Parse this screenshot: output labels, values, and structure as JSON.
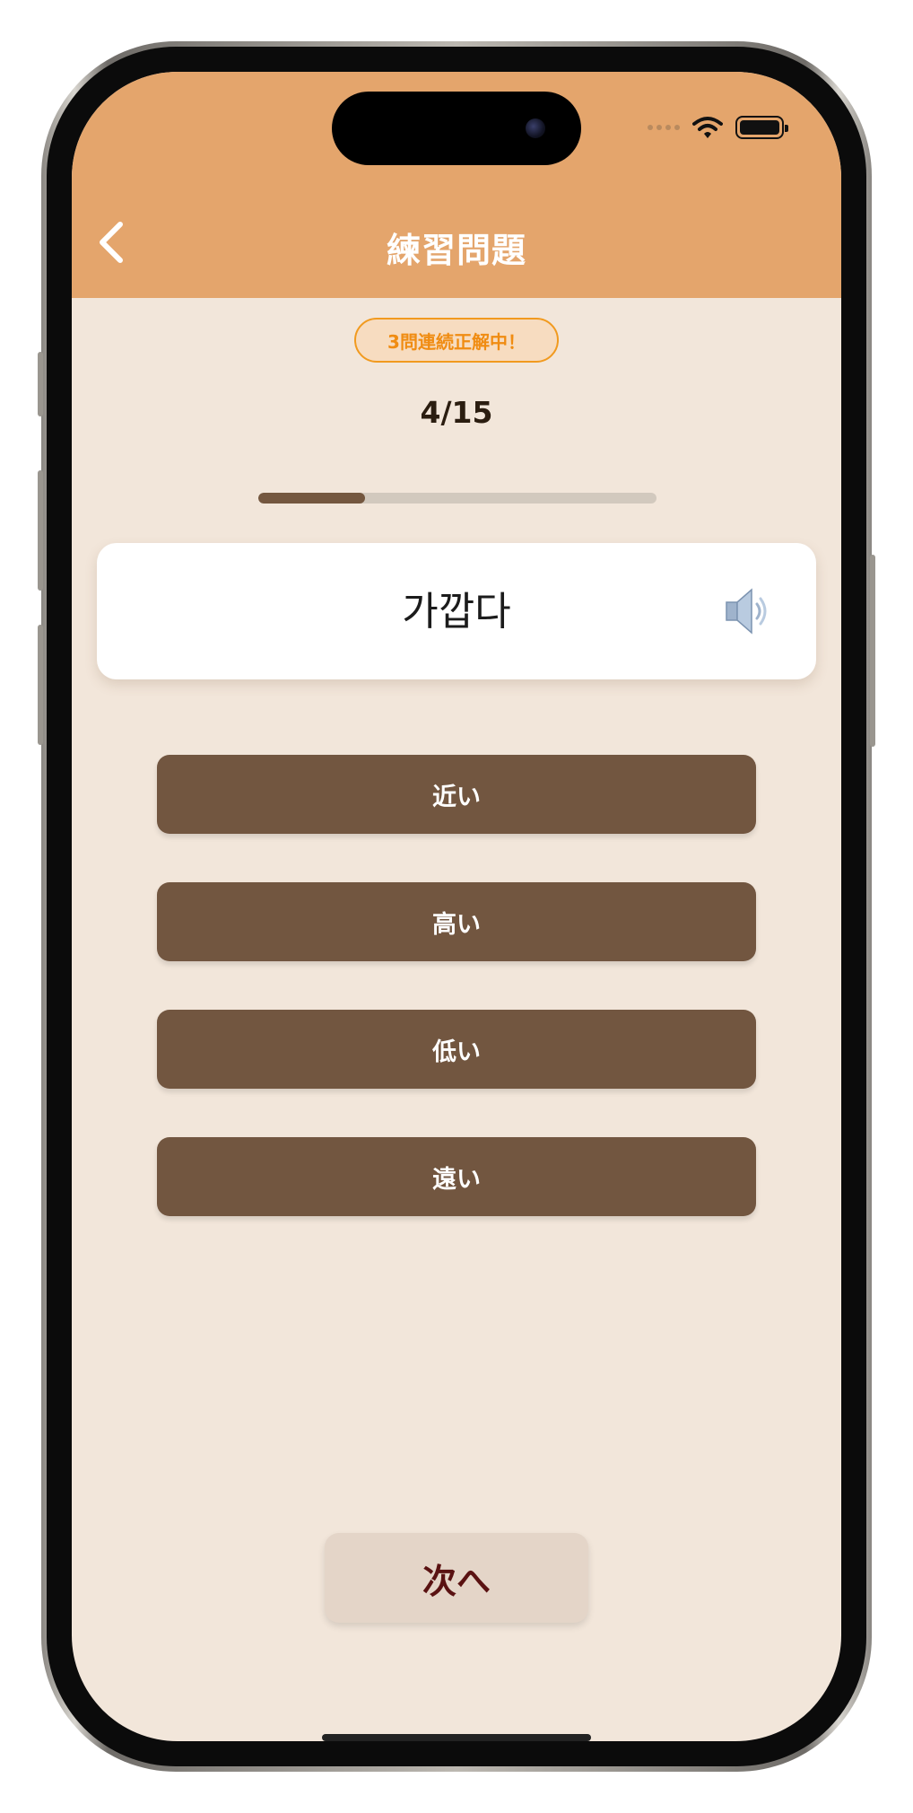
{
  "header": {
    "title": "練習問題",
    "background_color": "#e4a56c",
    "back_icon": "chevron-left-icon"
  },
  "status_bar": {
    "signal_icon": "signal-dots-icon",
    "wifi_icon": "wifi-icon",
    "battery_icon": "battery-icon"
  },
  "quiz": {
    "streak_badge": "3問連続正解中！",
    "progress_text": "4/15",
    "progress_fraction": 0.267,
    "word": "가깝다",
    "speaker_icon": "speaker-icon",
    "options": [
      {
        "label": "近い"
      },
      {
        "label": "高い"
      },
      {
        "label": "低い"
      },
      {
        "label": "遠い"
      }
    ],
    "next_label": "次へ"
  },
  "colors": {
    "background": "#f2e6da",
    "option_button": "#725640",
    "badge_border": "#f19a1f",
    "next_text": "#5a1212"
  }
}
